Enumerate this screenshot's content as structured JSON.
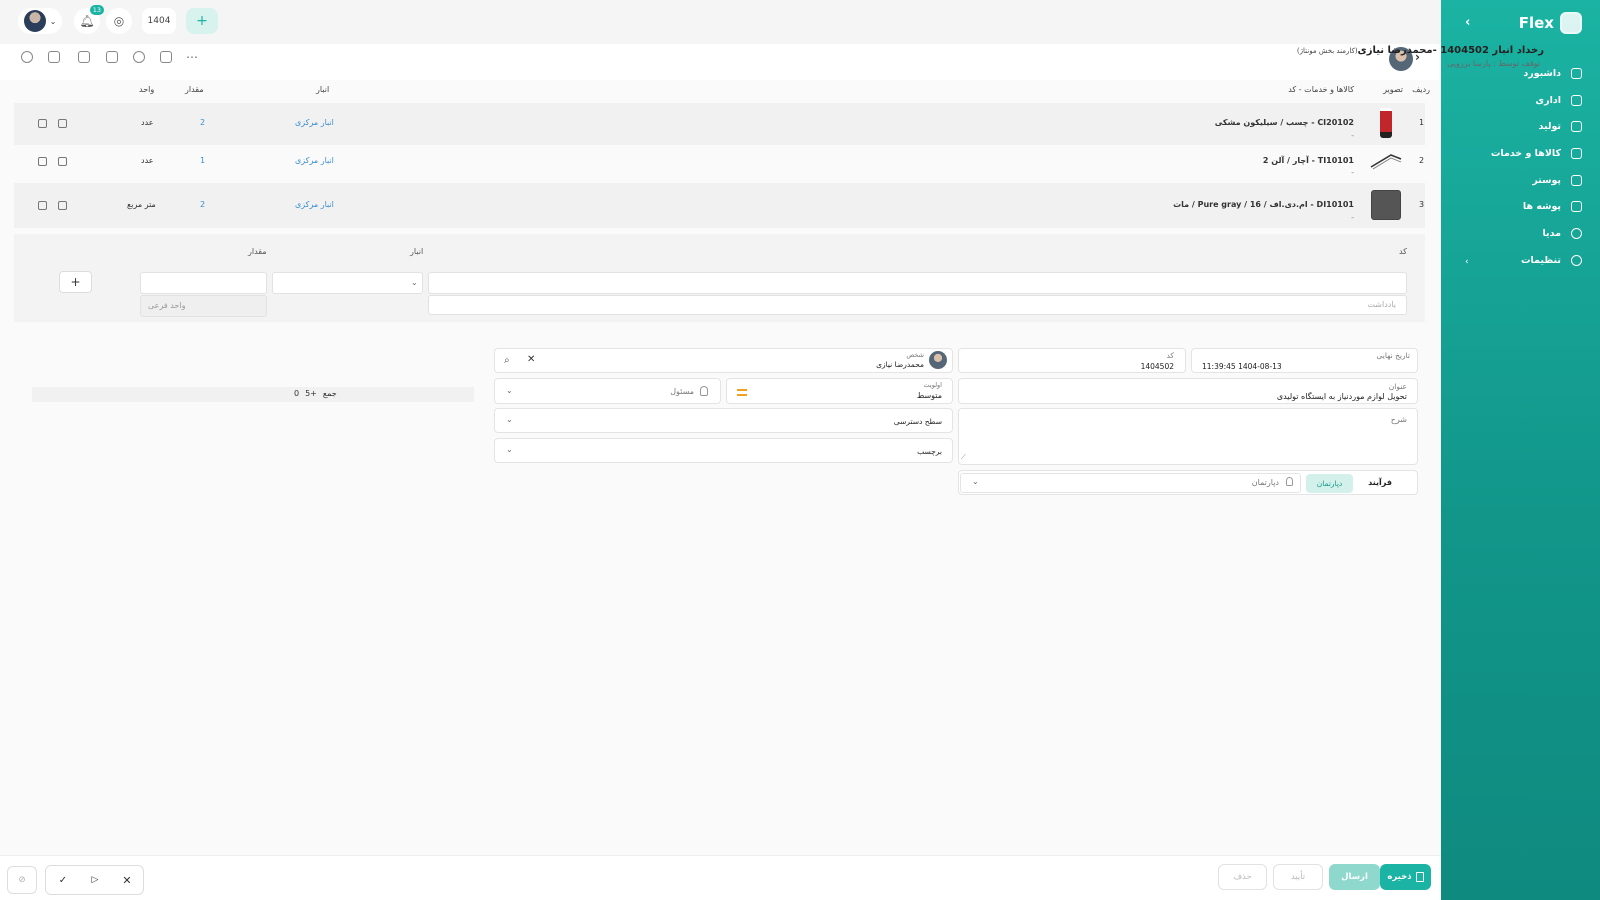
{
  "sidebar": {
    "brand": "Flex",
    "items": [
      {
        "label": "داشبورد",
        "icon": "home-icon"
      },
      {
        "label": "اداری",
        "icon": "briefcase-icon"
      },
      {
        "label": "تولید",
        "icon": "rocket-icon"
      },
      {
        "label": "کالاها و خدمات",
        "icon": "box-icon"
      },
      {
        "label": "پوستر",
        "icon": "image-icon"
      },
      {
        "label": "پوشه ها",
        "icon": "folder-icon"
      },
      {
        "label": "مدیا",
        "icon": "media-icon"
      },
      {
        "label": "تنظیمات",
        "icon": "gear-icon"
      }
    ]
  },
  "topbar": {
    "notification_count": "13",
    "year": "1404",
    "add_symbol": "+"
  },
  "header": {
    "title": "رخداد انبار 1404502 -محمدرضا نیازی",
    "title_note": "(کارمند بخش مونتاژ)",
    "subtitle": "توقف توسط : پارسا برزویی"
  },
  "table": {
    "headers": {
      "row": "ردیف",
      "image": "تصویر",
      "goods": "کالاها و خدمات - کد",
      "warehouse": "انبار",
      "quantity": "مقدار",
      "unit": "واحد"
    },
    "rows": [
      {
        "index": "1",
        "name": "CI20102 - چسب / سیلیکون مشکی",
        "note": "-",
        "warehouse": "انبار مرکزی",
        "quantity": "2",
        "unit": "عدد"
      },
      {
        "index": "2",
        "name": "TI10101 - آچار / آلن 2",
        "note": "-",
        "warehouse": "انبار مرکزی",
        "quantity": "1",
        "unit": "عدد"
      },
      {
        "index": "3",
        "name": "DI10101 - ام.دی.اف / 16 / Pure gray / مات",
        "note": "-",
        "warehouse": "انبار مرکزی",
        "quantity": "2",
        "unit": "متر مربع"
      }
    ]
  },
  "new_item": {
    "code_label": "کد",
    "warehouse_label": "انبار",
    "quantity_label": "مقدار",
    "note_placeholder": "یادداشت",
    "sub_unit_placeholder": "واحد فرعی",
    "add_symbol": "+"
  },
  "details": {
    "final_date_label": "تاریخ نهایی",
    "final_date": "1404-08-13 11:39:45",
    "code_label": "کد",
    "code": "1404502",
    "person_label": "شخص",
    "person": "محمدرضا نیازی",
    "title_label": "عنوان",
    "title_value": "تحویل لوازم موردنیاز به ایستگاه تولیدی",
    "priority_label": "اولویت",
    "priority": "متوسط",
    "responsible_placeholder": "مسئول",
    "description_label": "شرح",
    "access_level": "سطح دسترسی",
    "tag": "برچسب",
    "process_label": "فرآیند",
    "department_tab": "دپارتمان",
    "department_placeholder": "دپارتمان"
  },
  "summary": {
    "sum_label": "جمع",
    "sum_count": "5+",
    "sum_value": "0"
  },
  "footer": {
    "save": "ذخیره",
    "send": "ارسال",
    "approve": "تأیید",
    "remove": "حذف"
  }
}
